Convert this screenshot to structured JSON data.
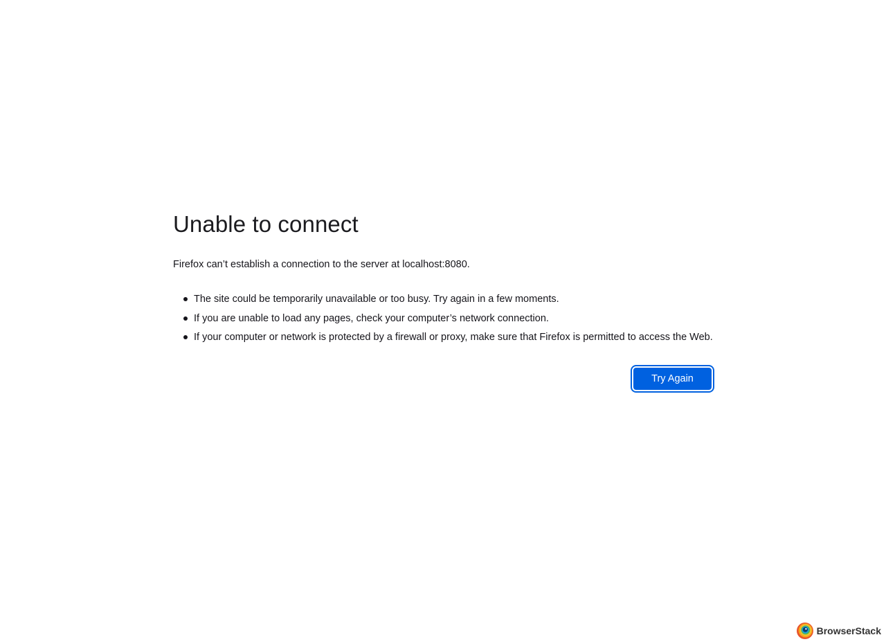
{
  "error": {
    "title": "Unable to connect",
    "description": "Firefox can’t establish a connection to the server at localhost:8080.",
    "suggestions": [
      "The site could be temporarily unavailable or too busy. Try again in a few moments.",
      "If you are unable to load any pages, check your computer’s network connection.",
      "If your computer or network is protected by a firewall or proxy, make sure that Firefox is permitted to access the Web."
    ],
    "button_label": "Try Again",
    "accent_color": "#0061e0"
  },
  "badge": {
    "text": "BrowserStack",
    "icon": "browserstack-logo-icon"
  }
}
